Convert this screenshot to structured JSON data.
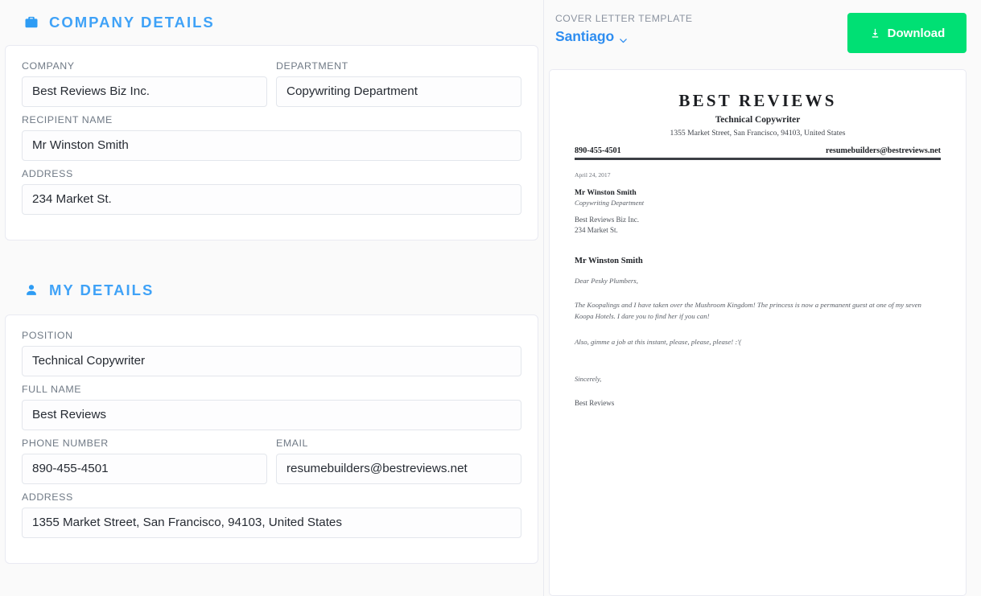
{
  "company_section": {
    "icon": "briefcase-icon",
    "title": "COMPANY DETAILS",
    "fields": {
      "company_label": "COMPANY",
      "company_value": "Best Reviews Biz Inc.",
      "department_label": "DEPARTMENT",
      "department_value": "Copywriting Department",
      "recipient_label": "RECIPIENT NAME",
      "recipient_value": "Mr Winston Smith",
      "address_label": "ADDRESS",
      "address_value": "234 Market St."
    }
  },
  "my_details_section": {
    "icon": "person-icon",
    "title": "MY DETAILS",
    "fields": {
      "position_label": "POSITION",
      "position_value": "Technical Copywriter",
      "fullname_label": "FULL NAME",
      "fullname_value": "Best Reviews",
      "phone_label": "PHONE NUMBER",
      "phone_value": "890-455-4501",
      "email_label": "EMAIL",
      "email_value": "resumebuilders@bestreviews.net",
      "address_label": "ADDRESS",
      "address_value": "1355 Market Street, San Francisco, 94103, United States"
    }
  },
  "preview": {
    "template_label": "COVER LETTER TEMPLATE",
    "template_name": "Santiago",
    "download_label": "Download",
    "download_icon": "download-icon",
    "chevron_icon": "chevron-down-icon"
  },
  "letter": {
    "header_name": "BEST REVIEWS",
    "header_position": "Technical Copywriter",
    "header_address": "1355 Market Street, San Francisco, 94103, United States",
    "header_phone": "890-455-4501",
    "header_email": "resumebuilders@bestreviews.net",
    "date": "April 24, 2017",
    "recipient_name": "Mr Winston Smith",
    "recipient_department": "Copywriting Department",
    "recipient_company": "Best Reviews Biz Inc.",
    "recipient_address": "234 Market St.",
    "salutation_name": "Mr Winston Smith",
    "greeting": "Dear Pesky Plumbers,",
    "paragraph_1": "The Koopalings and I have taken over the Mushroom Kingdom! The princess is now a permanent guest at one of my seven Koopa Hotels. I dare you to find her if you can!",
    "paragraph_2": "Also, gimme a job at this instant, please, please, please! :'(",
    "closing": "Sincerely,",
    "signature": "Best Reviews"
  },
  "colors": {
    "accent_blue": "#3fa2f7",
    "download_green": "#00e074",
    "page_background": "#fafafa",
    "card_background": "#ffffff",
    "border": "#e9eaf2"
  }
}
